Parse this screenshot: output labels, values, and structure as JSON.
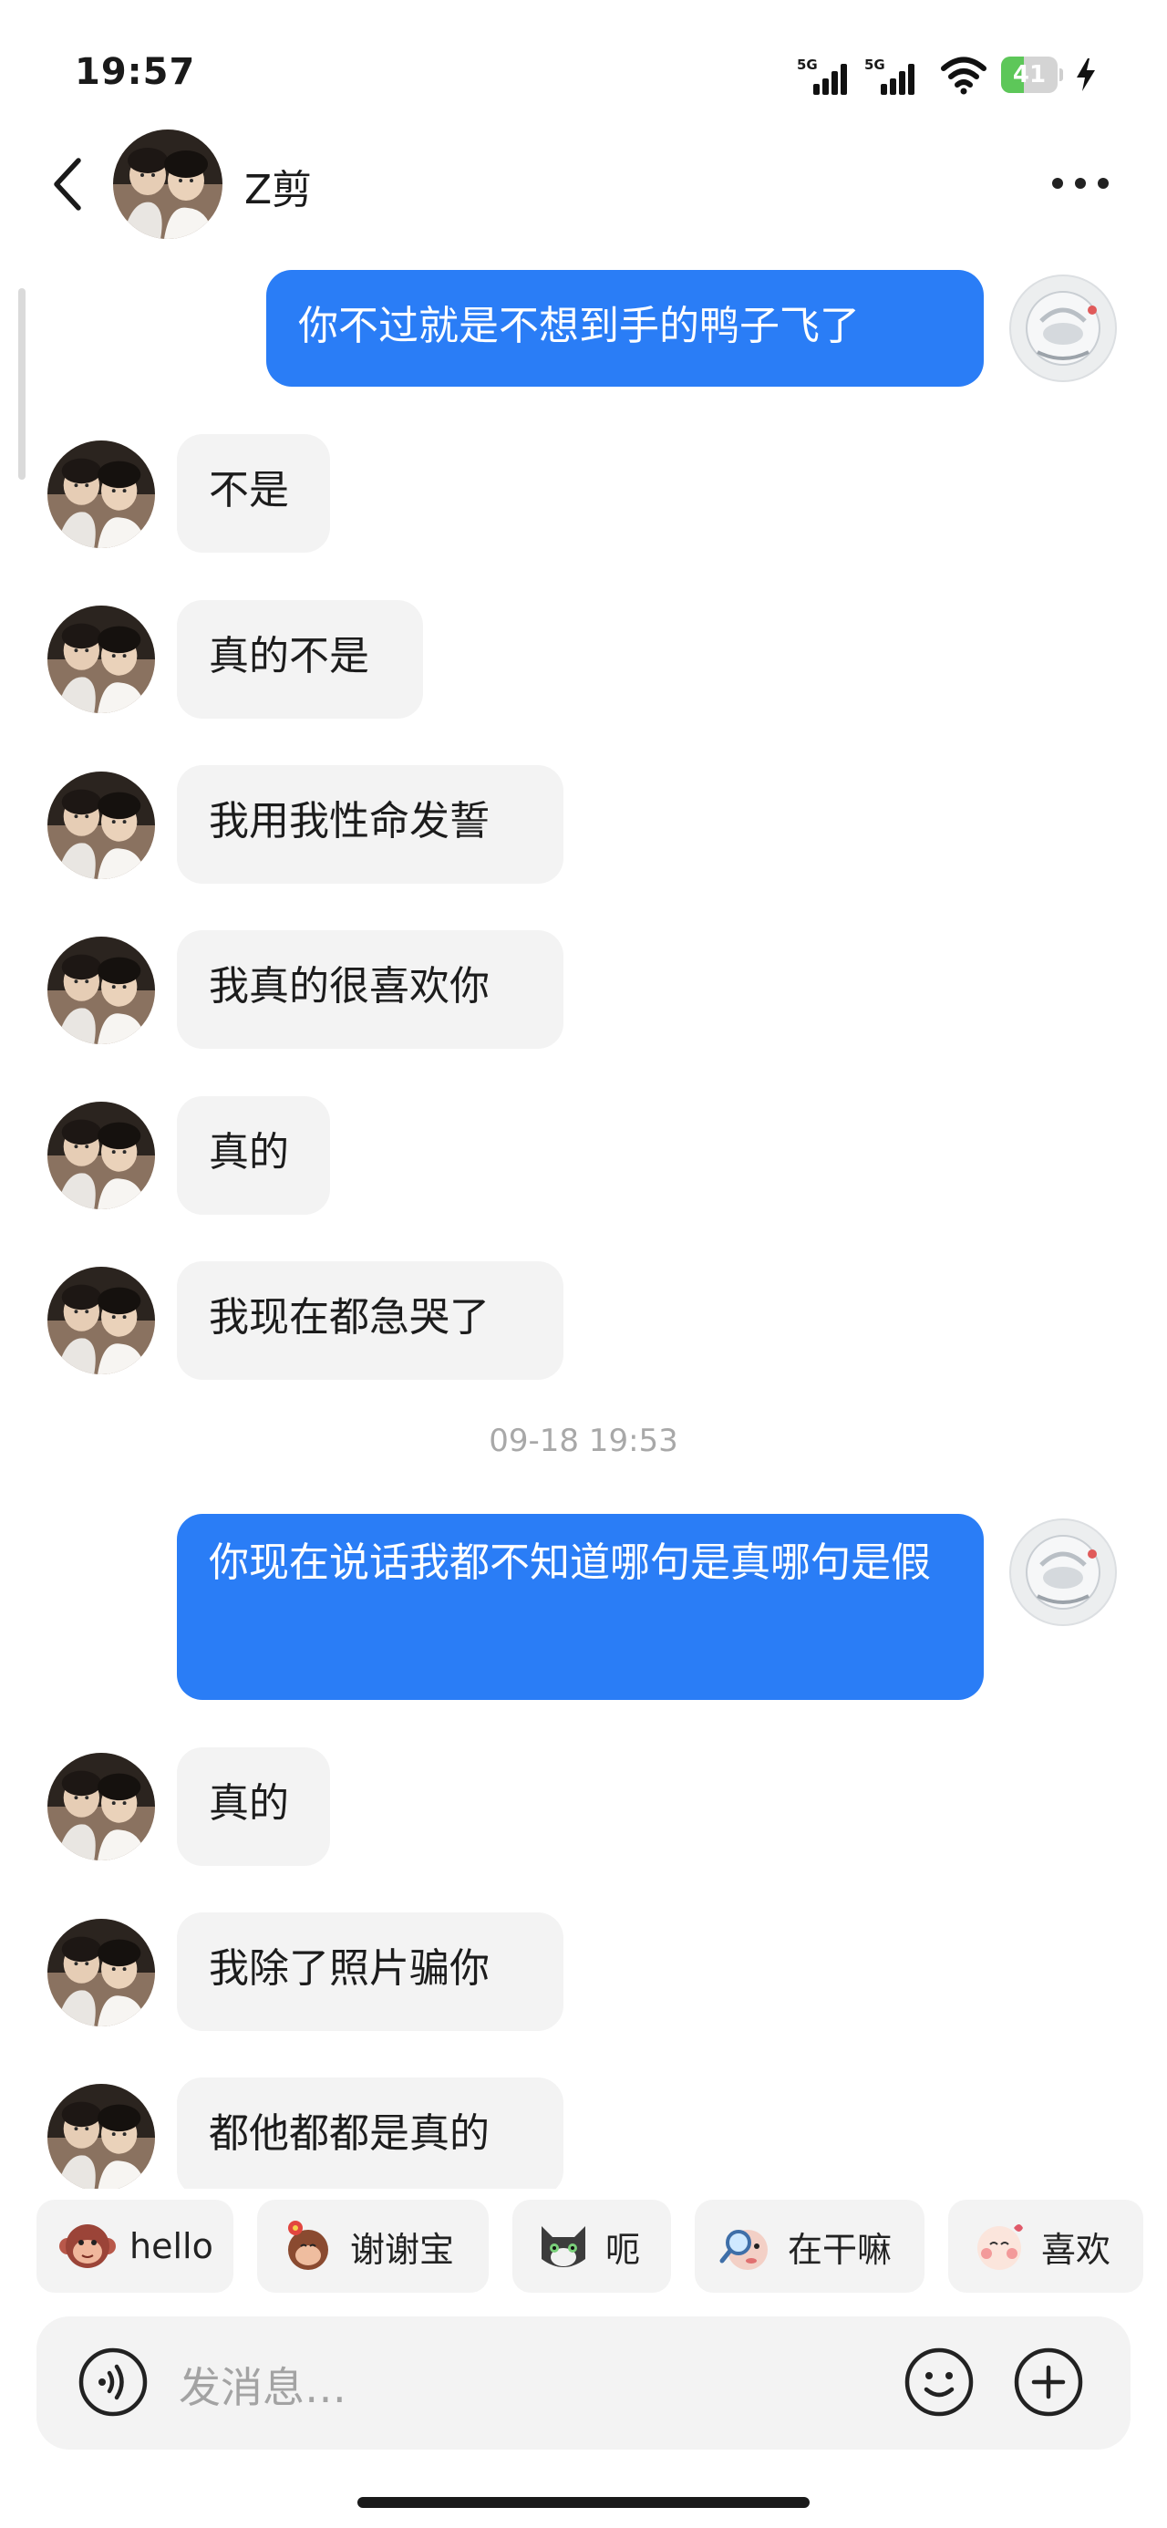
{
  "status_bar": {
    "time": "19:57",
    "signal1_label": "5G",
    "signal2_label": "5G",
    "battery_level": "41"
  },
  "header": {
    "contact_name": "Z剪"
  },
  "messages": [
    {
      "side": "out",
      "text": "你不过就是不想到手的鸭子飞了"
    },
    {
      "side": "in",
      "text": "不是"
    },
    {
      "side": "in",
      "text": "真的不是"
    },
    {
      "side": "in",
      "text": "我用我性命发誓"
    },
    {
      "side": "in",
      "text": "我真的很喜欢你"
    },
    {
      "side": "in",
      "text": "真的"
    },
    {
      "side": "in",
      "text": "我现在都急哭了"
    },
    {
      "side": "out",
      "text": "你现在说话我都不知道哪句是真哪句是假"
    },
    {
      "side": "in",
      "text": "真的"
    },
    {
      "side": "in",
      "text": "我除了照片骗你"
    },
    {
      "side": "in",
      "text": "都他都都是真的"
    }
  ],
  "timestamp": "09-18 19:53",
  "quick_replies": [
    {
      "label": "hello",
      "icon": "monkey-sticker-icon"
    },
    {
      "label": "谢谢宝",
      "icon": "flower-monkey-sticker-icon"
    },
    {
      "label": "呃",
      "icon": "cat-sticker-icon"
    },
    {
      "label": "在干嘛",
      "icon": "magnifier-sticker-icon"
    },
    {
      "label": "喜欢",
      "icon": "blush-sticker-icon"
    }
  ],
  "input": {
    "placeholder": "发消息…"
  },
  "colors": {
    "outgoing_bubble": "#2a7df6",
    "incoming_bubble": "#f3f3f3",
    "battery": "#5dc759"
  }
}
